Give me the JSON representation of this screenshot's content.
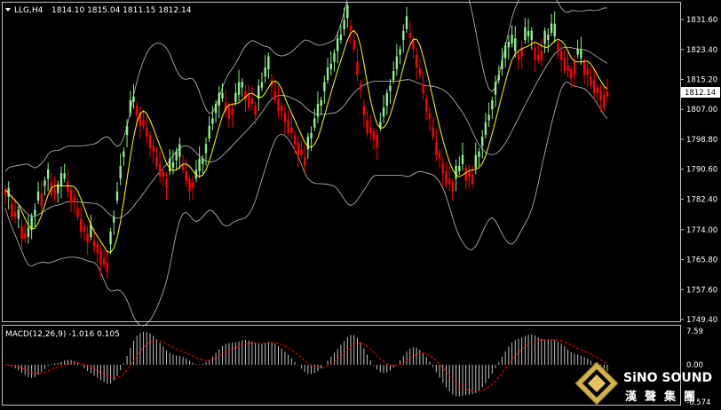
{
  "header": {
    "symbol": "LLG,H4",
    "ohlc": "1814.10 1815.04 1811.15 1812.14"
  },
  "price_axis": {
    "ticks": [
      "1831.60",
      "1823.40",
      "1815.20",
      "1807.00",
      "1798.80",
      "1790.60",
      "1782.40",
      "1774.00",
      "1765.80",
      "1757.60",
      "1749.40"
    ],
    "current": "1812.14"
  },
  "macd": {
    "label": "MACD(12,26,9) -1.016 0.105",
    "ticks": [
      "7.59",
      "0.00",
      "-6.574"
    ]
  },
  "colors": {
    "background": "#000000",
    "bull_candle": "#ff0000",
    "bear_candle": "#90ee90",
    "ma_fast": "#ffff00",
    "bands": "#c0c0c0",
    "grid_frame": "#c0c0c0",
    "macd_hist": "#c0c0c0",
    "macd_signal": "#ff0000"
  },
  "logo": {
    "text_en": "SiNO SOUND",
    "text_cn": "漢聲集團"
  },
  "chart_data": {
    "type": "candlestick",
    "ylim": [
      1749.4,
      1836
    ],
    "close": [
      1785,
      1783,
      1781,
      1779,
      1777,
      1775,
      1773,
      1772,
      1774,
      1778,
      1782,
      1784,
      1786,
      1788,
      1787,
      1785,
      1784,
      1786,
      1788,
      1787,
      1785,
      1783,
      1780,
      1777,
      1775,
      1773,
      1772,
      1771,
      1770,
      1768,
      1766,
      1765,
      1770,
      1776,
      1782,
      1788,
      1794,
      1800,
      1806,
      1809,
      1808,
      1806,
      1804,
      1802,
      1800,
      1797,
      1794,
      1792,
      1790,
      1788,
      1790,
      1791,
      1793,
      1794,
      1792,
      1790,
      1788,
      1787,
      1788,
      1790,
      1792,
      1795,
      1799,
      1803,
      1806,
      1808,
      1810,
      1809,
      1808,
      1807,
      1809,
      1811,
      1813,
      1812,
      1811,
      1810,
      1808,
      1810,
      1813,
      1816,
      1818,
      1815,
      1812,
      1810,
      1808,
      1806,
      1804,
      1802,
      1800,
      1798,
      1796,
      1794,
      1796,
      1799,
      1802,
      1805,
      1808,
      1812,
      1815,
      1818,
      1820,
      1823,
      1826,
      1829,
      1832,
      1830,
      1826,
      1820,
      1814,
      1808,
      1804,
      1802,
      1801,
      1800,
      1802,
      1805,
      1808,
      1812,
      1815,
      1818,
      1822,
      1826,
      1829,
      1828,
      1826,
      1822,
      1818,
      1814,
      1810,
      1806,
      1802,
      1798,
      1795,
      1792,
      1790,
      1788,
      1787,
      1788,
      1790,
      1792,
      1791,
      1790,
      1789,
      1791,
      1794,
      1797,
      1800,
      1804,
      1807,
      1811,
      1815,
      1818,
      1821,
      1824,
      1825,
      1823,
      1822,
      1824,
      1826,
      1827,
      1826,
      1824,
      1822,
      1823,
      1825,
      1826,
      1828,
      1827,
      1825,
      1823,
      1821,
      1819,
      1818,
      1820,
      1822,
      1821,
      1820,
      1818,
      1816,
      1815,
      1813,
      1812,
      1811,
      1812
    ],
    "open_offset": [
      1,
      -1,
      1,
      1,
      -1,
      1,
      1,
      -1,
      -1,
      -1,
      -1,
      1,
      -1,
      -1,
      1,
      1,
      -1,
      -1,
      -1,
      1,
      1,
      1,
      1,
      1,
      1,
      1,
      -1,
      1,
      1,
      1,
      1,
      1,
      -1,
      -1,
      -1,
      -1,
      -1,
      -1,
      -1,
      -1,
      1,
      1,
      1,
      1,
      1,
      1,
      1,
      1,
      1,
      1,
      -1,
      -1,
      -1,
      -1,
      1,
      1,
      1,
      1,
      -1,
      -1,
      -1,
      -1,
      -1,
      -1,
      -1,
      -1,
      -1,
      1,
      1,
      1,
      -1,
      -1,
      -1,
      1,
      1,
      1,
      1,
      -1,
      -1,
      -1,
      -1,
      1,
      1,
      1,
      1,
      1,
      1,
      1,
      1,
      1,
      1,
      1,
      -1,
      -1,
      -1,
      -1,
      -1,
      -1,
      -1,
      -1,
      -1,
      -1,
      -1,
      -1,
      -1,
      1,
      1,
      1,
      1,
      1,
      1,
      1,
      1,
      1,
      -1,
      -1,
      -1,
      -1,
      -1,
      -1,
      -1,
      -1,
      -1,
      1,
      1,
      1,
      1,
      1,
      1,
      1,
      1,
      1,
      1,
      1,
      1,
      1,
      1,
      -1,
      -1,
      -1,
      1,
      1,
      1,
      -1,
      -1,
      -1,
      -1,
      -1,
      -1,
      -1,
      -1,
      -1,
      -1,
      -1,
      -1,
      -1,
      1,
      1,
      -1,
      -1,
      -1,
      1,
      1,
      1,
      -1,
      -1,
      -1,
      -1,
      1,
      1,
      1,
      1,
      1,
      1,
      -1,
      -1,
      1,
      1,
      1,
      1,
      1,
      1,
      1,
      1,
      -1
    ]
  }
}
